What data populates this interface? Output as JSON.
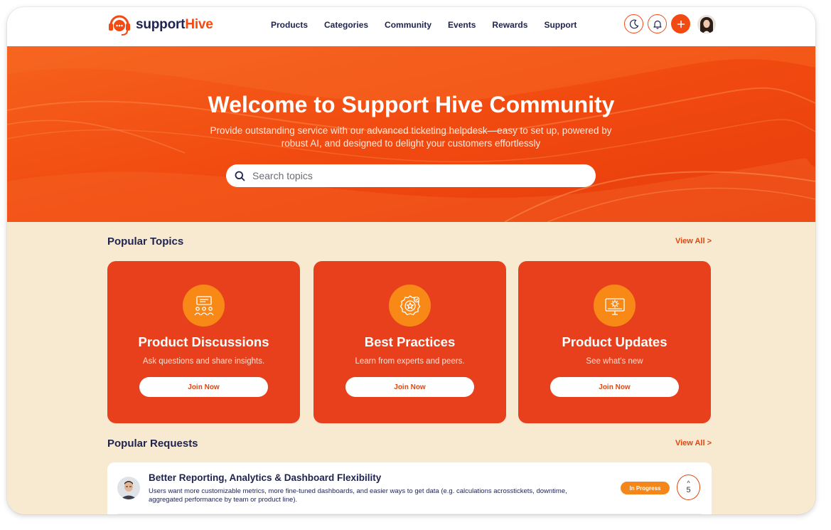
{
  "brand": {
    "name_part1": "support",
    "name_part2": "Hive",
    "primary": "#f24a12",
    "navy": "#1e2350",
    "cream": "#f8ead0"
  },
  "nav": {
    "items": [
      "Products",
      "Categories",
      "Community",
      "Events",
      "Rewards",
      "Support"
    ]
  },
  "header_icons": [
    "moon-icon",
    "bell-icon",
    "plus-icon",
    "user-avatar"
  ],
  "hero": {
    "title": "Welcome to Support Hive Community",
    "subtitle": "Provide outstanding service with our advanced ticketing helpdesk—easy to set up, powered by robust AI, and designed to delight your customers effortlessly",
    "search_placeholder": "Search topics"
  },
  "popular_topics": {
    "title": "Popular Topics",
    "view_all": "View All >",
    "cards": [
      {
        "icon": "presentation-icon",
        "title": "Product Discussions",
        "desc": "Ask questions and share insights.",
        "button": "Join Now"
      },
      {
        "icon": "award-badge-icon",
        "title": "Best Practices",
        "desc": "Learn from experts and peers.",
        "button": "Join Now"
      },
      {
        "icon": "monitor-gear-icon",
        "title": "Product Updates",
        "desc": "See what's new",
        "button": "Join Now"
      }
    ]
  },
  "popular_requests": {
    "title": "Popular Requests",
    "view_all": "View All >",
    "items": [
      {
        "title": "Better Reporting, Analytics & Dashboard Flexibility",
        "desc": "Users want more customizable metrics, more fine-tuned dashboards, and easier ways to get data (e.g. calculations acrosstickets, downtime, aggregated performance by team or product line).",
        "status": "In Progress",
        "votes": "5"
      }
    ]
  }
}
